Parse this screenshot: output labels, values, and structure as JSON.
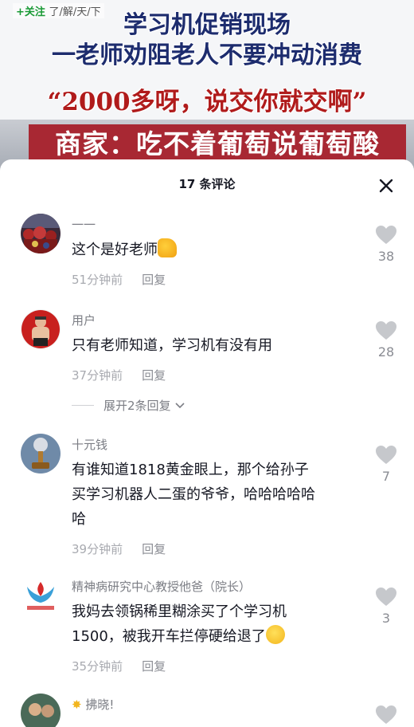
{
  "banner": {
    "follow": "+关注",
    "channel": "了/解/天/下",
    "headline_line1": "学习机促销现场",
    "headline_line2": "一老师劝阻老人不要冲动消费",
    "quote": "“2000多呀，说交你就交啊”",
    "caption": "商家：吃不着葡萄说葡萄酸"
  },
  "sheet": {
    "title": "17 条评论"
  },
  "comments": [
    {
      "name": "一一",
      "text": "这个是好老师",
      "emoji": "thumbs-up",
      "time": "51分钟前",
      "reply": "回复",
      "likes": "38"
    },
    {
      "name": "用户",
      "text": "只有老师知道，学习机有没有用",
      "time": "37分钟前",
      "reply": "回复",
      "likes": "28",
      "expand": "展开2条回复"
    },
    {
      "name": "十元钱",
      "text": "有谁知道1818黄金眼上，那个给孙子买学习机器人二蛋的爷爷，哈哈哈哈哈哈",
      "text_lines": [
        "有谁知道1818黄金眼上，那个给孙子",
        "买学习机器人二蛋的爷爷，哈哈哈哈哈",
        "哈"
      ],
      "time": "39分钟前",
      "reply": "回复",
      "likes": "7"
    },
    {
      "name": "精神病研究中心教授他爸（院长）",
      "text": "我妈去领锅稀里糊涂买了个学习机1500，被我开车拦停硬给退了",
      "text_lines": [
        "我妈去领锅稀里糊涂买了个学习机",
        "1500，被我开车拦停硬给退了"
      ],
      "emoji": "laughing",
      "time": "35分钟前",
      "reply": "回复",
      "likes": "3"
    },
    {
      "name": "拂晓!"
    }
  ],
  "colors": {
    "like_gray": "#c6c8cc",
    "banner_red": "#a82833",
    "headline_blue": "#1d2c6e"
  }
}
